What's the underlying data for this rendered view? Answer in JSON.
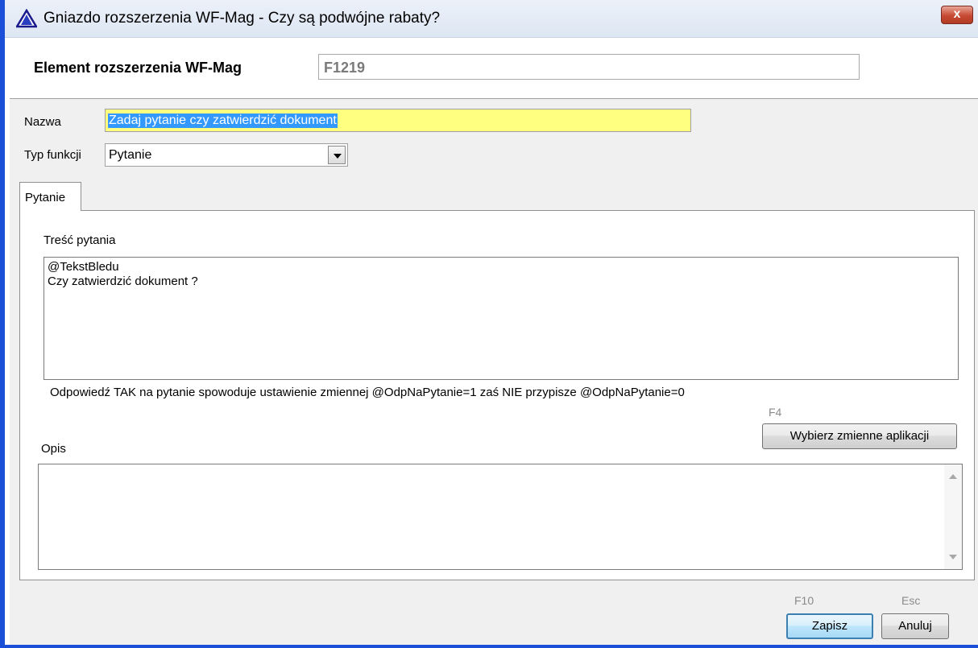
{
  "window": {
    "title": "Gniazdo rozszerzenia WF-Mag - Czy są podwójne rabaty?",
    "close_label": "x"
  },
  "header": {
    "element_label": "Element rozszerzenia WF-Mag",
    "element_value": "F1219"
  },
  "form": {
    "nazwa_label": "Nazwa",
    "nazwa_value": "Zadaj pytanie czy zatwierdzić dokument",
    "typ_label": "Typ funkcji",
    "typ_value": "Pytanie"
  },
  "tabs": [
    {
      "label": "Pytanie"
    }
  ],
  "pytanie": {
    "label": "Treść pytania",
    "lines": [
      "@TekstBledu",
      "Czy zatwierdzić dokument ?"
    ],
    "info": "Odpowiedź TAK na pytanie spowoduje ustawienie zmiennej @OdpNaPytanie=1 zaś NIE przypisze @OdpNaPytanie=0",
    "choose_hotkey": "F4",
    "choose_label": "Wybierz zmienne aplikacji",
    "opis_label": "Opis",
    "opis_value": ""
  },
  "footer": {
    "save_hotkey": "F10",
    "save_label": "Zapisz",
    "cancel_hotkey": "Esc",
    "cancel_label": "Anuluj"
  },
  "colors": {
    "titlebar": "#dde6f3",
    "frame": "#1c4fd8",
    "nazwa_field_bg": "#ffff80",
    "selection": "#3399ff",
    "close_button": "#c74a33"
  },
  "icons": {
    "app": "warning-triangle-icon",
    "close": "close-icon"
  }
}
